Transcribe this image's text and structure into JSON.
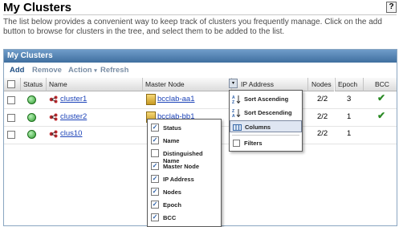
{
  "page": {
    "title": "My Clusters",
    "help_label": "?",
    "description": "The list below provides a convenient way to keep track of clusters you frequently manage. Click on the add button to browse for clusters in the tree, and select them to be added to the list."
  },
  "panel": {
    "title": "My Clusters",
    "toolbar": {
      "add": "Add",
      "remove": "Remove",
      "action": "Action",
      "action_arrow": "▾",
      "refresh": "Refresh"
    },
    "columns": {
      "status": "Status",
      "name": "Name",
      "master_node": "Master Node",
      "ip_address": "IP Address",
      "nodes": "Nodes",
      "epoch": "Epoch",
      "bcc": "BCC"
    },
    "rows": [
      {
        "name": "cluster1",
        "master_node": "bcclab-aa1",
        "nodes": "2/2",
        "epoch": "3",
        "bcc": "✔"
      },
      {
        "name": "cluster2",
        "master_node": "bcclab-bb1",
        "nodes": "2/2",
        "epoch": "1",
        "bcc": "✔"
      },
      {
        "name": "clus10",
        "master_node": "",
        "nodes": "2/2",
        "epoch": "1",
        "bcc": ""
      }
    ]
  },
  "column_menu": {
    "dropdown_glyph": "▾",
    "items": [
      {
        "label": "Sort Ascending",
        "icon": "sort-ascending-icon"
      },
      {
        "label": "Sort Descending",
        "icon": "sort-descending-icon"
      },
      {
        "label": "Columns",
        "icon": "columns-icon"
      },
      {
        "label": "Filters",
        "icon": "filters-icon"
      }
    ]
  },
  "columns_submenu": {
    "check_glyph": "✓",
    "items": [
      {
        "label": "Status",
        "checked": true
      },
      {
        "label": "Name",
        "checked": true
      },
      {
        "label": "Distinguished Name",
        "checked": false
      },
      {
        "label": "Master Node",
        "checked": true
      },
      {
        "label": "IP Address",
        "checked": true
      },
      {
        "label": "Nodes",
        "checked": true
      },
      {
        "label": "Epoch",
        "checked": true
      },
      {
        "label": "BCC",
        "checked": true
      }
    ]
  },
  "colors": {
    "header_bar": "#4f7fb0",
    "link": "#1c43b8",
    "status_ok": "#2e9b2e",
    "check_green": "#2a8a25"
  }
}
